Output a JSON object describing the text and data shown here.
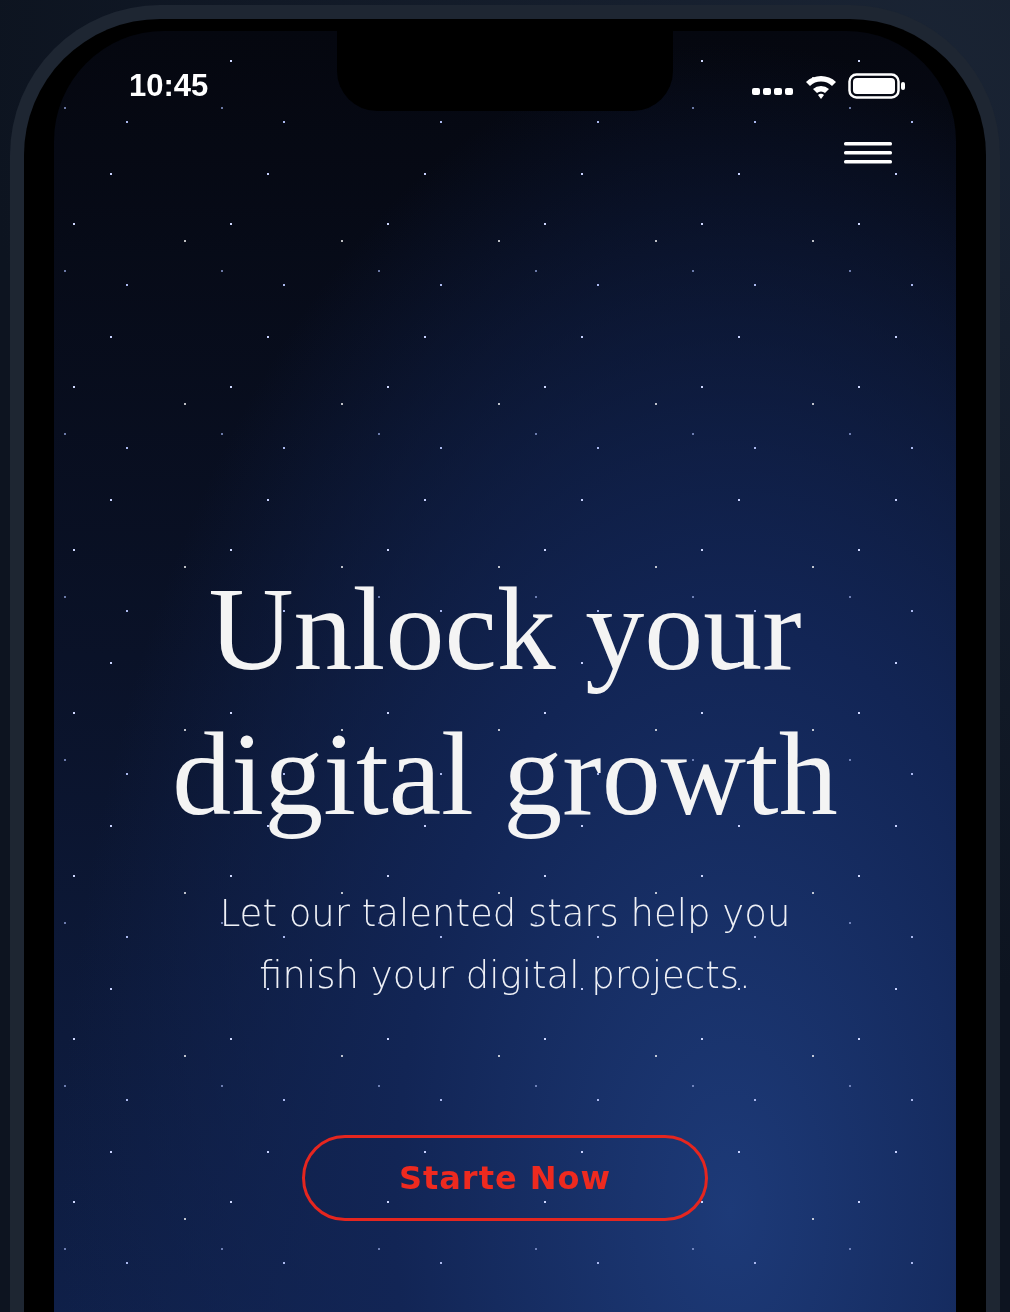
{
  "status_bar": {
    "time": "10:45"
  },
  "hero": {
    "title_lines": [
      "Unlock your",
      "digital growth"
    ],
    "subtitle_lines": [
      "Let our talented stars help you",
      "finish your digital projects."
    ]
  },
  "cta_button": {
    "label": "Starte Now"
  }
}
